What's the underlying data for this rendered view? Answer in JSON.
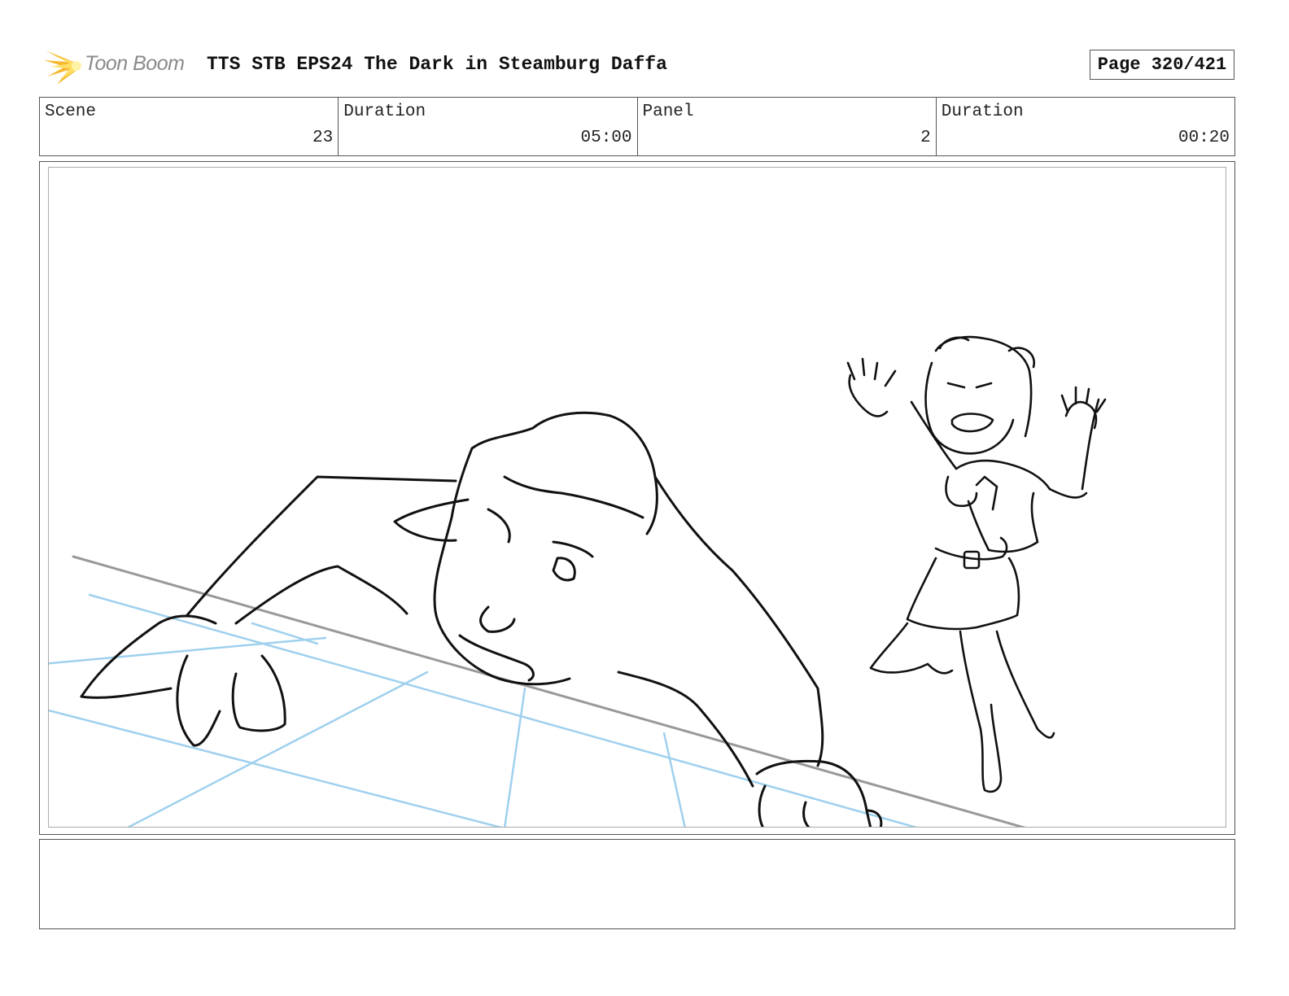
{
  "header": {
    "logo_text": "Toon Boom",
    "title": "TTS STB EPS24 The Dark in Steamburg Daffa",
    "page": "Page 320/421"
  },
  "info": [
    {
      "label": "Scene",
      "value": "23"
    },
    {
      "label": "Duration",
      "value": "05:00"
    },
    {
      "label": "Panel",
      "value": "2"
    },
    {
      "label": "Duration",
      "value": "00:20"
    }
  ],
  "notes": "",
  "colors": {
    "sketch_line": "#111111",
    "guide_line": "#9fd0ee",
    "horizon_line": "#999999",
    "logo_orange": "#f5a623",
    "logo_yellow": "#ffd23f"
  }
}
